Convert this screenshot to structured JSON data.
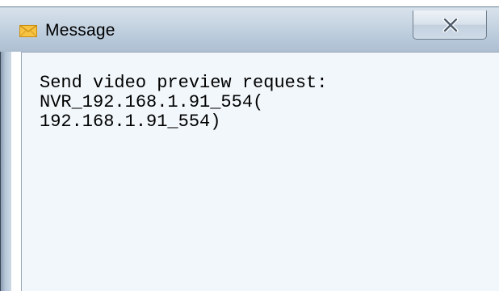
{
  "window": {
    "title": "Message",
    "title_icon": "envelope-icon",
    "close_label": "x",
    "close_icon": "close-icon"
  },
  "message": {
    "lines": [
      "Send video preview request:",
      "NVR_192.168.1.91_554(",
      "192.168.1.91_554)"
    ]
  },
  "colors": {
    "titlebar": "#c4d2e0",
    "content_background": "#f2f7fb",
    "text": "#000000",
    "envelope": "#f6c343"
  }
}
